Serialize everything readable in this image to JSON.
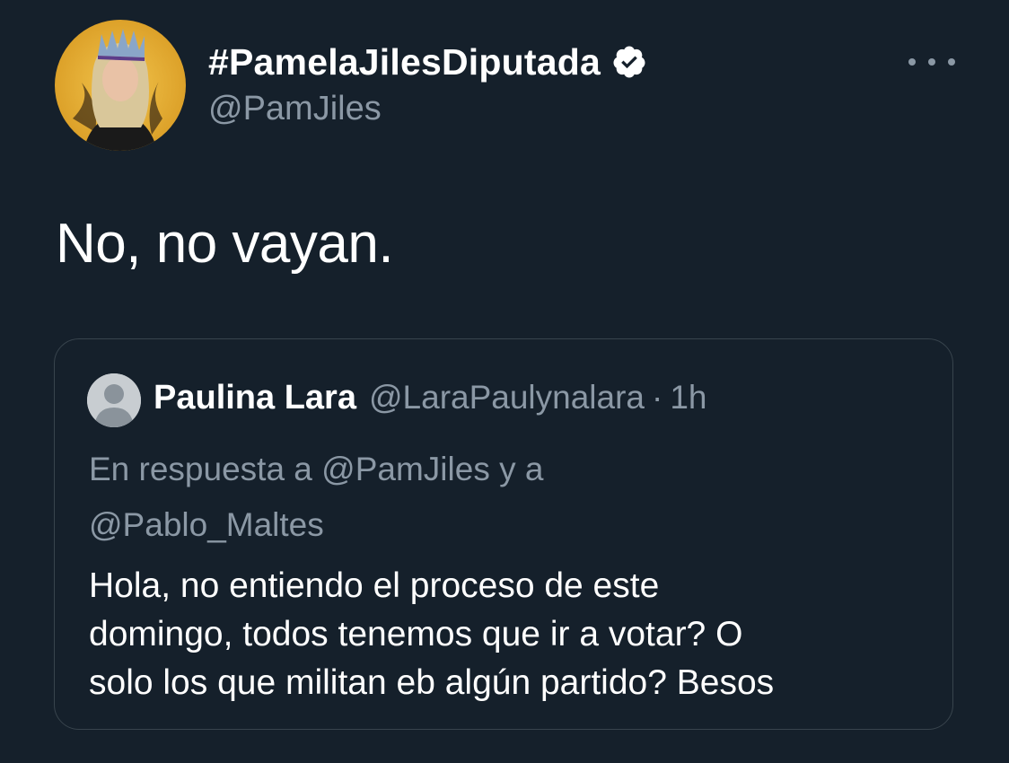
{
  "tweet": {
    "display_name": "#PamelaJilesDiputada",
    "handle": "@PamJiles",
    "verified_icon": "verified-badge-icon",
    "more_icon": "more-options-icon",
    "text": "No, no vayan."
  },
  "quoted_tweet": {
    "display_name": "Paulina Lara",
    "handle": "@LaraPaulynalara",
    "separator": "·",
    "time": "1h",
    "reply_line_1": "En respuesta a @PamJiles y a",
    "reply_line_2": "@Pablo_Maltes",
    "body_lines": [
      "Hola, no entiendo el proceso de este",
      "domingo, todos tenemos que ir a votar? O",
      "solo los que militan eb algún partido? Besos"
    ]
  },
  "colors": {
    "background": "#15202b",
    "secondary_text": "#8b98a5",
    "border": "#38444d",
    "avatar_ring": "#e8b23a"
  }
}
